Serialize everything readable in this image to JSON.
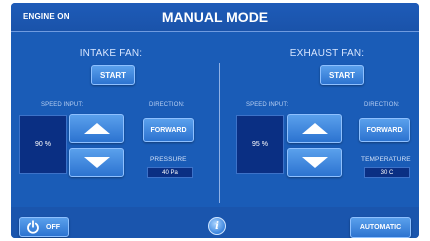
{
  "header": {
    "engine_status": "ENGINE ON",
    "title": "MANUAL MODE"
  },
  "intake": {
    "title": "INTAKE FAN:",
    "start_label": "START",
    "speed_label": "SPEED INPUT:",
    "speed_value": "90 %",
    "direction_label": "DIRECTION:",
    "direction_value": "FORWARD",
    "sensor_label": "PRESSURE",
    "sensor_value": "40 Pa"
  },
  "exhaust": {
    "title": "EXHAUST FAN:",
    "start_label": "START",
    "speed_label": "SPEED INPUT:",
    "speed_value": "95 %",
    "direction_label": "DIRECTION:",
    "direction_value": "FORWARD",
    "sensor_label": "TEMPERATURE",
    "sensor_value": "30 C"
  },
  "footer": {
    "off_label": "OFF",
    "auto_label": "AUTOMATIC",
    "info_icon": "info-icon",
    "power_icon": "power-icon"
  },
  "colors": {
    "background": "#1a5cb7",
    "button": "#3f86dc",
    "field": "#0a2f83",
    "text": "#ffffff"
  }
}
